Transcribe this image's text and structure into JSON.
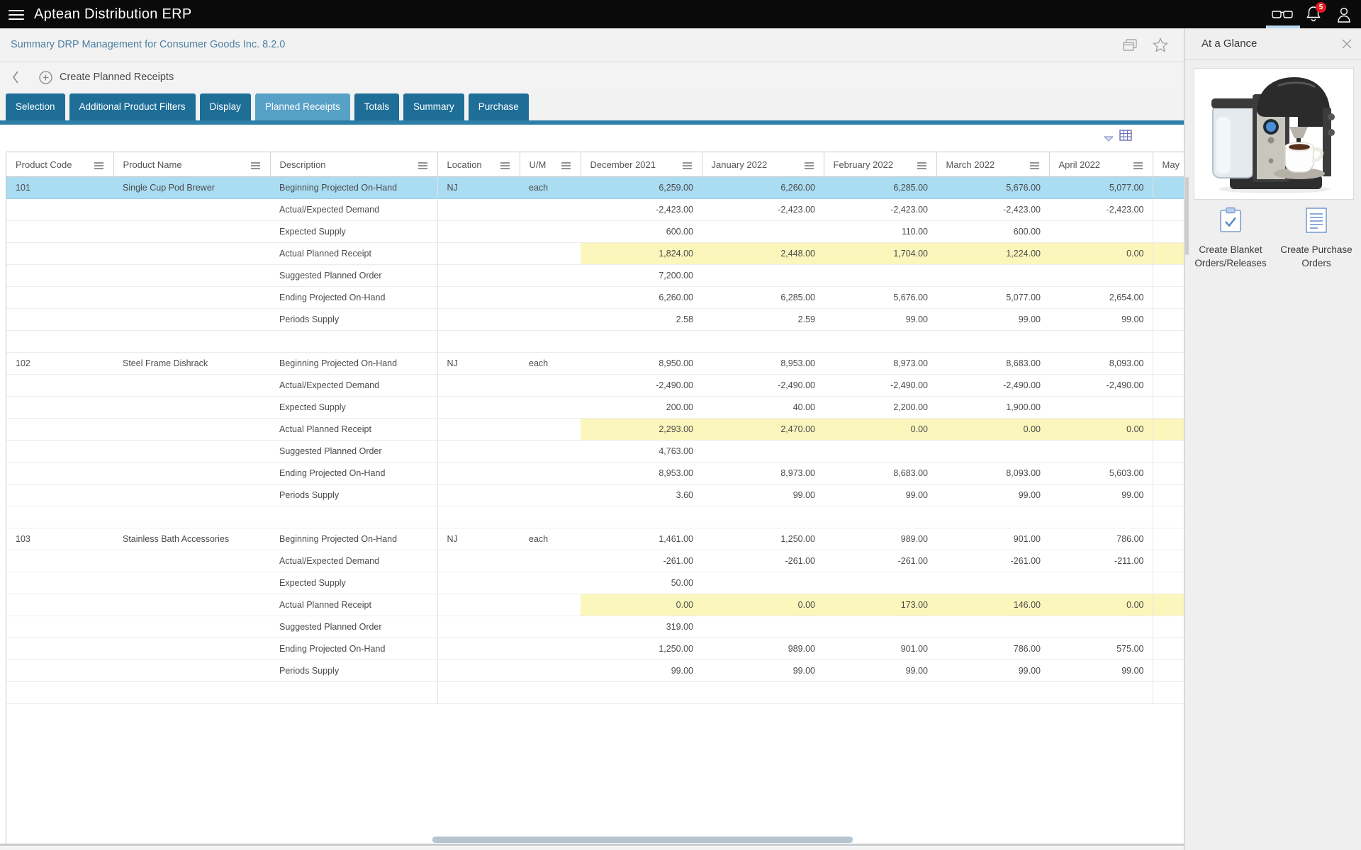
{
  "colors": {
    "topbar_bg": "#0a0a0a",
    "link_blue": "#4d7fa3",
    "tab_inactive": "#1e6e98",
    "tab_active": "#57a0c6",
    "tab_underline": "#2e7ea7",
    "selected_row": "#aadcf2",
    "highlight_cell": "#fbf6bc",
    "badge_red": "#e11b22",
    "scroll_thumb": "#b6c6cf"
  },
  "app": {
    "title": "Aptean Distribution ERP",
    "notification_count": "5",
    "icons": [
      "menu-icon",
      "glasses-icon",
      "bell-icon",
      "user-icon"
    ]
  },
  "page": {
    "title": "Summary DRP Management for Consumer Goods Inc. 8.2.0",
    "icons": [
      "open-windows-icon",
      "favorite-star-icon"
    ]
  },
  "breadcrumb": {
    "title": "Create Planned Receipts",
    "icons": [
      "back-chevron-icon",
      "circle-plus-icon"
    ]
  },
  "tabs": [
    {
      "label": "Selection",
      "active": false
    },
    {
      "label": "Additional Product Filters",
      "active": false
    },
    {
      "label": "Display",
      "active": false
    },
    {
      "label": "Planned Receipts",
      "active": true
    },
    {
      "label": "Totals",
      "active": false
    },
    {
      "label": "Summary",
      "active": false
    },
    {
      "label": "Purchase",
      "active": false
    }
  ],
  "grid_tools": {
    "icons": [
      "collapse-chevron-icon",
      "column-chooser-icon"
    ]
  },
  "table": {
    "columns": [
      "Product Code",
      "Product Name",
      "Description",
      "Location",
      "U/M",
      "December 2021",
      "January 2022",
      "February 2022",
      "March 2022",
      "April 2022",
      "May"
    ],
    "products": [
      {
        "code": "101",
        "name": "Single Cup Pod Brewer",
        "location": "NJ",
        "uom": "each",
        "rows": [
          {
            "label": "Beginning Projected On-Hand",
            "selected": true,
            "values": [
              "6,259.00",
              "6,260.00",
              "6,285.00",
              "5,676.00",
              "5,077.00"
            ]
          },
          {
            "label": "Actual/Expected Demand",
            "values": [
              "-2,423.00",
              "-2,423.00",
              "-2,423.00",
              "-2,423.00",
              "-2,423.00"
            ]
          },
          {
            "label": "Expected Supply",
            "values": [
              "600.00",
              "",
              "110.00",
              "600.00",
              ""
            ]
          },
          {
            "label": "Actual Planned Receipt",
            "highlight": true,
            "values": [
              "1,824.00",
              "2,448.00",
              "1,704.00",
              "1,224.00",
              "0.00"
            ]
          },
          {
            "label": "Suggested Planned Order",
            "values": [
              "7,200.00",
              "",
              "",
              "",
              ""
            ]
          },
          {
            "label": "Ending Projected On-Hand",
            "values": [
              "6,260.00",
              "6,285.00",
              "5,676.00",
              "5,077.00",
              "2,654.00"
            ]
          },
          {
            "label": "Periods Supply",
            "values": [
              "2.58",
              "2.59",
              "99.00",
              "99.00",
              "99.00"
            ]
          }
        ]
      },
      {
        "code": "102",
        "name": "Steel Frame Dishrack",
        "location": "NJ",
        "uom": "each",
        "rows": [
          {
            "label": "Beginning Projected On-Hand",
            "values": [
              "8,950.00",
              "8,953.00",
              "8,973.00",
              "8,683.00",
              "8,093.00"
            ]
          },
          {
            "label": "Actual/Expected Demand",
            "values": [
              "-2,490.00",
              "-2,490.00",
              "-2,490.00",
              "-2,490.00",
              "-2,490.00"
            ]
          },
          {
            "label": "Expected Supply",
            "values": [
              "200.00",
              "40.00",
              "2,200.00",
              "1,900.00",
              ""
            ]
          },
          {
            "label": "Actual Planned Receipt",
            "highlight": true,
            "values": [
              "2,293.00",
              "2,470.00",
              "0.00",
              "0.00",
              "0.00"
            ]
          },
          {
            "label": "Suggested Planned Order",
            "values": [
              "4,763.00",
              "",
              "",
              "",
              ""
            ]
          },
          {
            "label": "Ending Projected On-Hand",
            "values": [
              "8,953.00",
              "8,973.00",
              "8,683.00",
              "8,093.00",
              "5,603.00"
            ]
          },
          {
            "label": "Periods Supply",
            "values": [
              "3.60",
              "99.00",
              "99.00",
              "99.00",
              "99.00"
            ]
          }
        ]
      },
      {
        "code": "103",
        "name": "Stainless Bath Accessories",
        "location": "NJ",
        "uom": "each",
        "rows": [
          {
            "label": "Beginning Projected On-Hand",
            "values": [
              "1,461.00",
              "1,250.00",
              "989.00",
              "901.00",
              "786.00"
            ]
          },
          {
            "label": "Actual/Expected Demand",
            "values": [
              "-261.00",
              "-261.00",
              "-261.00",
              "-261.00",
              "-211.00"
            ]
          },
          {
            "label": "Expected Supply",
            "values": [
              "50.00",
              "",
              "",
              "",
              ""
            ]
          },
          {
            "label": "Actual Planned Receipt",
            "highlight": true,
            "values": [
              "0.00",
              "0.00",
              "173.00",
              "146.00",
              "0.00"
            ]
          },
          {
            "label": "Suggested Planned Order",
            "values": [
              "319.00",
              "",
              "",
              "",
              ""
            ]
          },
          {
            "label": "Ending Projected On-Hand",
            "values": [
              "1,250.00",
              "989.00",
              "901.00",
              "786.00",
              "575.00"
            ]
          },
          {
            "label": "Periods Supply",
            "values": [
              "99.00",
              "99.00",
              "99.00",
              "99.00",
              "99.00"
            ]
          }
        ]
      }
    ]
  },
  "panel": {
    "title": "At a Glance",
    "close_icon": "close-icon",
    "image": "single-cup-pod-brewer-product-photo",
    "actions": [
      {
        "label": "Create Blanket Orders/Releases",
        "icon": "clipboard-check-icon"
      },
      {
        "label": "Create Purchase Orders",
        "icon": "document-lines-icon"
      }
    ]
  }
}
